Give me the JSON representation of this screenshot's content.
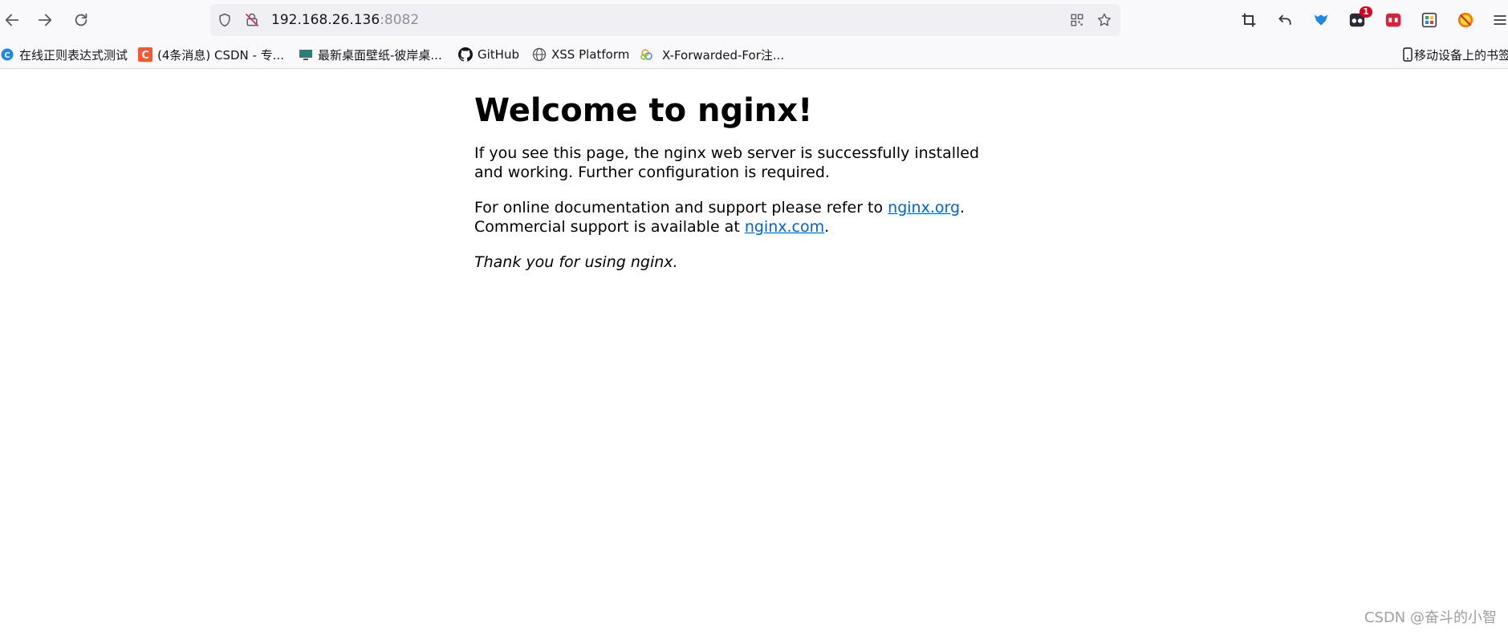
{
  "browser": {
    "url_host": "192.168.26.136",
    "url_port": ":8082",
    "icons": {
      "back": "back-arrow-icon",
      "forward": "forward-arrow-icon",
      "reload": "reload-icon",
      "shield": "tracking-protection-shield-icon",
      "insecure": "insecure-connection-icon",
      "qr": "qr-code-icon",
      "star": "bookmark-star-icon"
    },
    "extensions": [
      {
        "name": "crop-icon"
      },
      {
        "name": "undo-arrow-icon"
      },
      {
        "name": "blue-bird-extension-icon"
      },
      {
        "name": "dark-extension-icon",
        "badge": "1"
      },
      {
        "name": "red-extension-icon"
      },
      {
        "name": "grid-extension-icon"
      },
      {
        "name": "no-entry-extension-icon"
      },
      {
        "name": "hamburger-menu-icon"
      }
    ]
  },
  "bookmarks": [
    {
      "label": "在线正则表达式测试",
      "icon": "regex-site-favicon"
    },
    {
      "label": "(4条消息) CSDN - 专...",
      "icon": "csdn-favicon"
    },
    {
      "label": "最新桌面壁纸-彼岸桌...",
      "icon": "wallpaper-site-favicon"
    },
    {
      "label": "GitHub",
      "icon": "github-favicon"
    },
    {
      "label": "XSS Platform",
      "icon": "globe-favicon"
    },
    {
      "label": "X-Forwarded-For注...",
      "icon": "cloud-favicon"
    }
  ],
  "mobile_bookmarks": "移动设备上的书签",
  "page": {
    "heading": "Welcome to nginx!",
    "p1": "If you see this page, the nginx web server is successfully installed and working. Further configuration is required.",
    "p2_before": "For online documentation and support please refer to ",
    "link1": "nginx.org",
    "p2_mid": ".",
    "p2_line2": "Commercial support is available at ",
    "link2": "nginx.com",
    "p2_end": ".",
    "thanks": "Thank you for using nginx."
  },
  "watermark": "CSDN @奋斗的小智",
  "colors": {
    "link": "#0060df",
    "toolbar": "#f9f9fb",
    "urlbar": "#f0f0f4",
    "badge": "#d70022"
  }
}
